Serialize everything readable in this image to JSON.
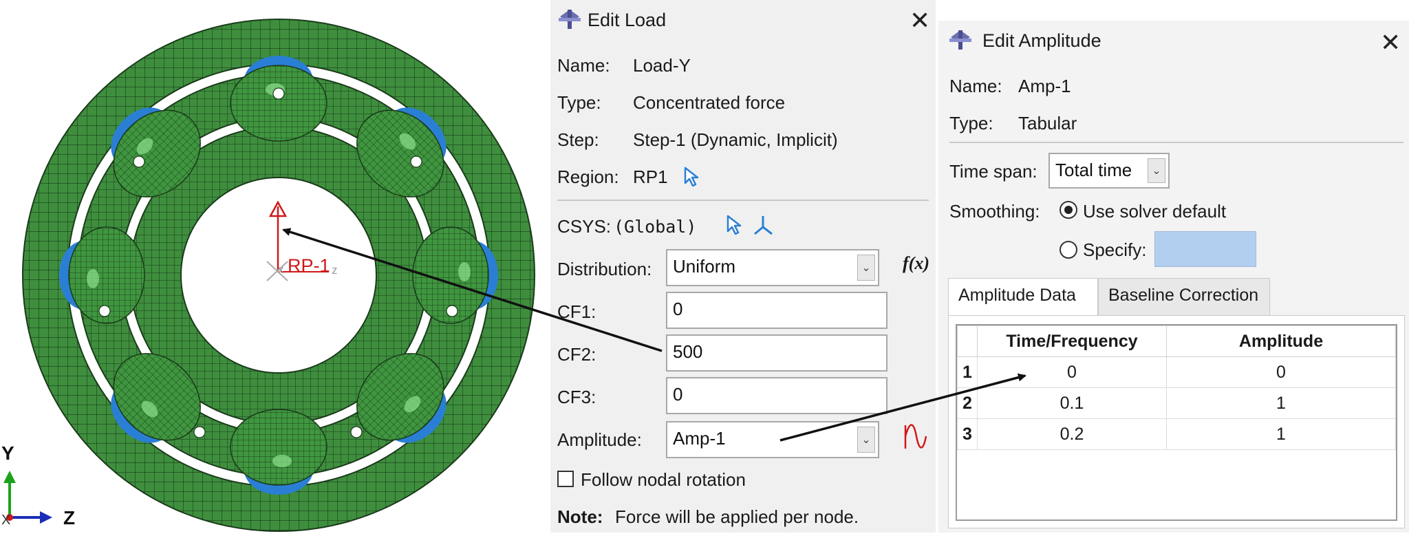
{
  "viewport": {
    "rp_label": "RP-1",
    "triad_x_small": "x",
    "triad_z_small": "z",
    "global_axes": {
      "y": "Y",
      "z": "Z",
      "x": "X"
    }
  },
  "edit_load": {
    "title": "Edit Load",
    "name_label": "Name:",
    "name_value": "Load-Y",
    "type_label": "Type:",
    "type_value": "Concentrated force",
    "step_label": "Step:",
    "step_value": "Step-1 (Dynamic, Implicit)",
    "region_label": "Region:",
    "region_value": "RP1",
    "csys_label": "CSYS:",
    "csys_value": "(Global)",
    "distribution_label": "Distribution:",
    "distribution_value": "Uniform",
    "fx_label": "f(x)",
    "cf1_label": "CF1:",
    "cf1_value": "0",
    "cf2_label": "CF2:",
    "cf2_value": "500",
    "cf3_label": "CF3:",
    "cf3_value": "0",
    "amplitude_label": "Amplitude:",
    "amplitude_value": "Amp-1",
    "follow_label": "Follow nodal rotation",
    "note_label": "Note:",
    "note_text": "Force will be applied per node."
  },
  "edit_amplitude": {
    "title": "Edit Amplitude",
    "name_label": "Name:",
    "name_value": "Amp-1",
    "type_label": "Type:",
    "type_value": "Tabular",
    "timespan_label": "Time span:",
    "timespan_value": "Total time",
    "smoothing_label": "Smoothing:",
    "use_default_label": "Use solver default",
    "specify_label": "Specify:",
    "tabs": [
      "Amplitude Data",
      "Baseline Correction"
    ],
    "table": {
      "headers": [
        "Time/Frequency",
        "Amplitude"
      ],
      "rows": [
        {
          "num": "1",
          "time": "0",
          "amp": "0"
        },
        {
          "num": "2",
          "time": "0.1",
          "amp": "1"
        },
        {
          "num": "3",
          "time": "0.2",
          "amp": "1"
        }
      ]
    }
  },
  "colors": {
    "mesh_green": "#3e8e3e",
    "roller_blue": "#2a7fd4",
    "rp_red": "#d01818",
    "field_blue": "#b3cfef"
  }
}
